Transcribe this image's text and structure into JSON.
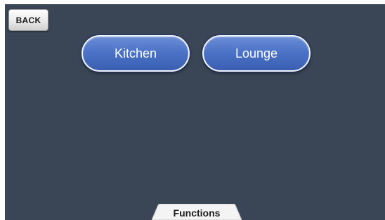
{
  "toolbar": {
    "back_label": "BACK"
  },
  "rooms": {
    "items": [
      {
        "label": "Kitchen"
      },
      {
        "label": "Lounge"
      }
    ]
  },
  "tabs": {
    "active_label": "Functions"
  },
  "colors": {
    "background": "#3a4656",
    "room_button": "#4c73c7",
    "room_button_border": "#f2f4fb",
    "tab": "#f4f4f4"
  }
}
